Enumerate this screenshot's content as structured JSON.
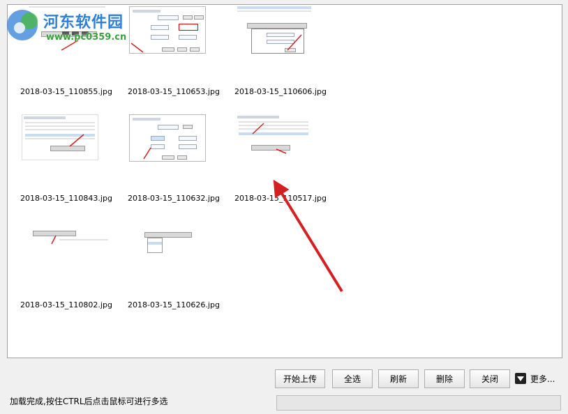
{
  "watermark": {
    "site": "河东软件园",
    "url": "www.pc0359.cn"
  },
  "thumbnails": [
    {
      "file": "2018-03-15_110855.jpg"
    },
    {
      "file": "2018-03-15_110653.jpg"
    },
    {
      "file": "2018-03-15_110606.jpg"
    },
    {
      "file": "2018-03-15_110843.jpg"
    },
    {
      "file": "2018-03-15_110632.jpg"
    },
    {
      "file": "2018-03-15_110517.jpg"
    },
    {
      "file": "2018-03-15_110802.jpg"
    },
    {
      "file": "2018-03-15_110626.jpg"
    }
  ],
  "toolbar": {
    "start_upload": "开始上传",
    "select_all": "全选",
    "refresh": "刷新",
    "delete": "删除",
    "close": "关闭",
    "more": "更多..."
  },
  "status": {
    "message": "加载完成,按住CTRL后点击鼠标可进行多选",
    "progress": 0
  },
  "colors": {
    "annotation_arrow": "#d42020",
    "progress_fill": "#06b025"
  }
}
